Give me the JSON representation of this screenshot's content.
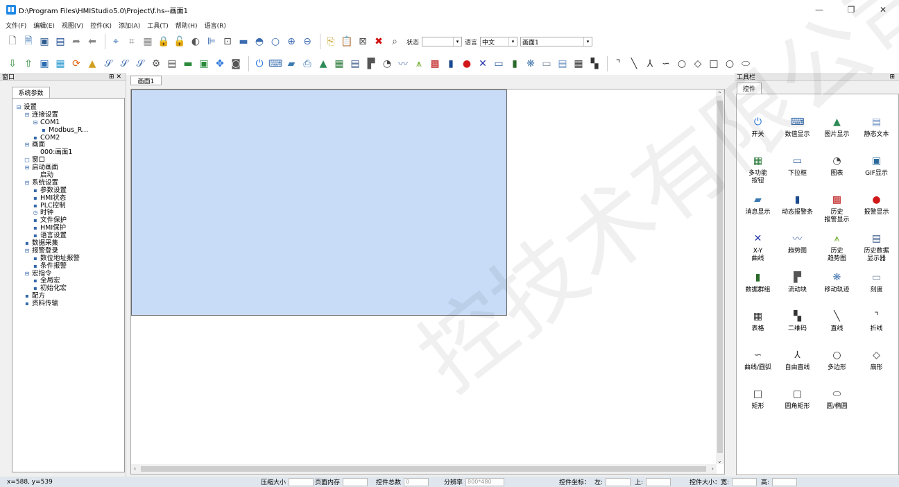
{
  "window": {
    "title": "D:\\Program Files\\HMIStudio5.0\\Project\\f.hs--画面1",
    "minimize": "—",
    "maximize": "❐",
    "close": "✕"
  },
  "menu": [
    "文件(F)",
    "编辑(E)",
    "视图(V)",
    "控件(K)",
    "添加(A)",
    "工具(T)",
    "帮助(H)",
    "语言(R)"
  ],
  "toolbar": {
    "state_label": "状态",
    "state_value": "",
    "lang_label": "语言",
    "lang_value": "中文",
    "screen_value": "画面1"
  },
  "left_panel": {
    "header": "窗口",
    "pin": "⊞ ✕",
    "tab": "系统参数",
    "tree": [
      {
        "level": 0,
        "icon": "⊟",
        "label": "设置"
      },
      {
        "level": 1,
        "icon": "⊟",
        "label": "连接设置"
      },
      {
        "level": 2,
        "icon": "⊟",
        "label": "COM1"
      },
      {
        "level": 3,
        "icon": "▪",
        "label": "Modbus_R..."
      },
      {
        "level": 2,
        "icon": "▪",
        "label": "COM2"
      },
      {
        "level": 1,
        "icon": "⊟",
        "label": "画面"
      },
      {
        "level": 2,
        "icon": "",
        "label": "000:画面1"
      },
      {
        "level": 1,
        "icon": "□",
        "label": "窗口"
      },
      {
        "level": 1,
        "icon": "⊟",
        "label": "启动画面"
      },
      {
        "level": 2,
        "icon": "",
        "label": "启动"
      },
      {
        "level": 1,
        "icon": "⊟",
        "label": "系统设置"
      },
      {
        "level": 2,
        "icon": "▪",
        "label": "参数设置"
      },
      {
        "level": 2,
        "icon": "▪",
        "label": "HMI状态"
      },
      {
        "level": 2,
        "icon": "▪",
        "label": "PLC控制"
      },
      {
        "level": 2,
        "icon": "◷",
        "label": "时钟"
      },
      {
        "level": 2,
        "icon": "▪",
        "label": "文件保护"
      },
      {
        "level": 2,
        "icon": "▪",
        "label": "HMI保护"
      },
      {
        "level": 2,
        "icon": "▪",
        "label": "语言设置"
      },
      {
        "level": 1,
        "icon": "▪",
        "label": "数据采集"
      },
      {
        "level": 1,
        "icon": "⊟",
        "label": "报警登录"
      },
      {
        "level": 2,
        "icon": "▪",
        "label": "数位地址报警"
      },
      {
        "level": 2,
        "icon": "▪",
        "label": "条件报警"
      },
      {
        "level": 1,
        "icon": "⊟",
        "label": "宏指令"
      },
      {
        "level": 2,
        "icon": "▪",
        "label": "全局宏"
      },
      {
        "level": 2,
        "icon": "▪",
        "label": "初始化宏"
      },
      {
        "level": 1,
        "icon": "▪",
        "label": "配方"
      },
      {
        "level": 1,
        "icon": "▪",
        "label": "资料传输"
      }
    ]
  },
  "doc_tab": "画面1",
  "right_panel": {
    "header": "工具栏",
    "pin": "⊞",
    "tab": "控件",
    "tools": [
      {
        "icon": "⏻",
        "label": "开关",
        "color": "#1e6ed8"
      },
      {
        "icon": "⌨",
        "label": "数值显示",
        "color": "#3a6fb0"
      },
      {
        "icon": "▲",
        "label": "图片显示",
        "color": "#2e8b57"
      },
      {
        "icon": "▤",
        "label": "静态文本",
        "color": "#6a8fc0"
      },
      {
        "icon": "▦",
        "label": "多功能\n按钮",
        "color": "#2a7a3a"
      },
      {
        "icon": "▭",
        "label": "下拉框",
        "color": "#2d5fa0"
      },
      {
        "icon": "◔",
        "label": "图表",
        "color": "#444"
      },
      {
        "icon": "▣",
        "label": "GIF显示",
        "color": "#2a6a9a"
      },
      {
        "icon": "▰",
        "label": "消息显示",
        "color": "#3a7ab0"
      },
      {
        "icon": "▮",
        "label": "动态报警条",
        "color": "#1a4a90"
      },
      {
        "icon": "▩",
        "label": "历史\n报警显示",
        "color": "#c02020"
      },
      {
        "icon": "●",
        "label": "报警显示",
        "color": "#d01818"
      },
      {
        "icon": "✕",
        "label": "X-Y\n曲线",
        "color": "#2233aa"
      },
      {
        "icon": "〰",
        "label": "趋势图",
        "color": "#5a7ab0"
      },
      {
        "icon": "⩚",
        "label": "历史\n趋势图",
        "color": "#6aaa2a"
      },
      {
        "icon": "▤",
        "label": "历史数据\n显示器",
        "color": "#3a5a8a"
      },
      {
        "icon": "▮",
        "label": "数据群组",
        "color": "#2a6a2a"
      },
      {
        "icon": "▛",
        "label": "流动块",
        "color": "#555"
      },
      {
        "icon": "❋",
        "label": "移动轨迹",
        "color": "#4a7ab0"
      },
      {
        "icon": "▭",
        "label": "刻度",
        "color": "#7a8aa0"
      },
      {
        "icon": "▦",
        "label": "表格",
        "color": "#333"
      },
      {
        "icon": "▚",
        "label": "二维码",
        "color": "#333"
      },
      {
        "icon": "╲",
        "label": "直线",
        "color": "#333"
      },
      {
        "icon": "⌝",
        "label": "折线",
        "color": "#333"
      },
      {
        "icon": "∽",
        "label": "曲线/圆弧",
        "color": "#333"
      },
      {
        "icon": "⅄",
        "label": "自由直线",
        "color": "#333"
      },
      {
        "icon": "○",
        "label": "多边形",
        "color": "#333"
      },
      {
        "icon": "◇",
        "label": "扇形",
        "color": "#333"
      },
      {
        "icon": "□",
        "label": "矩形",
        "color": "#333"
      },
      {
        "icon": "▢",
        "label": "圆角矩形",
        "color": "#333"
      },
      {
        "icon": "⬭",
        "label": "圆/椭圆",
        "color": "#333"
      }
    ]
  },
  "status": {
    "coords": "x=588, y=539",
    "compress_label": "压缩大小",
    "mem_label": "页面内存",
    "count_label": "控件总数",
    "count_value": "0",
    "res_label": "分辨率",
    "res_value": "800*480",
    "pos_label": "控件坐标：",
    "left_label": "左:",
    "top_label": "上:",
    "size_label": "控件大小：宽:",
    "height_label": "高:"
  },
  "watermark": "控技术有限公司"
}
